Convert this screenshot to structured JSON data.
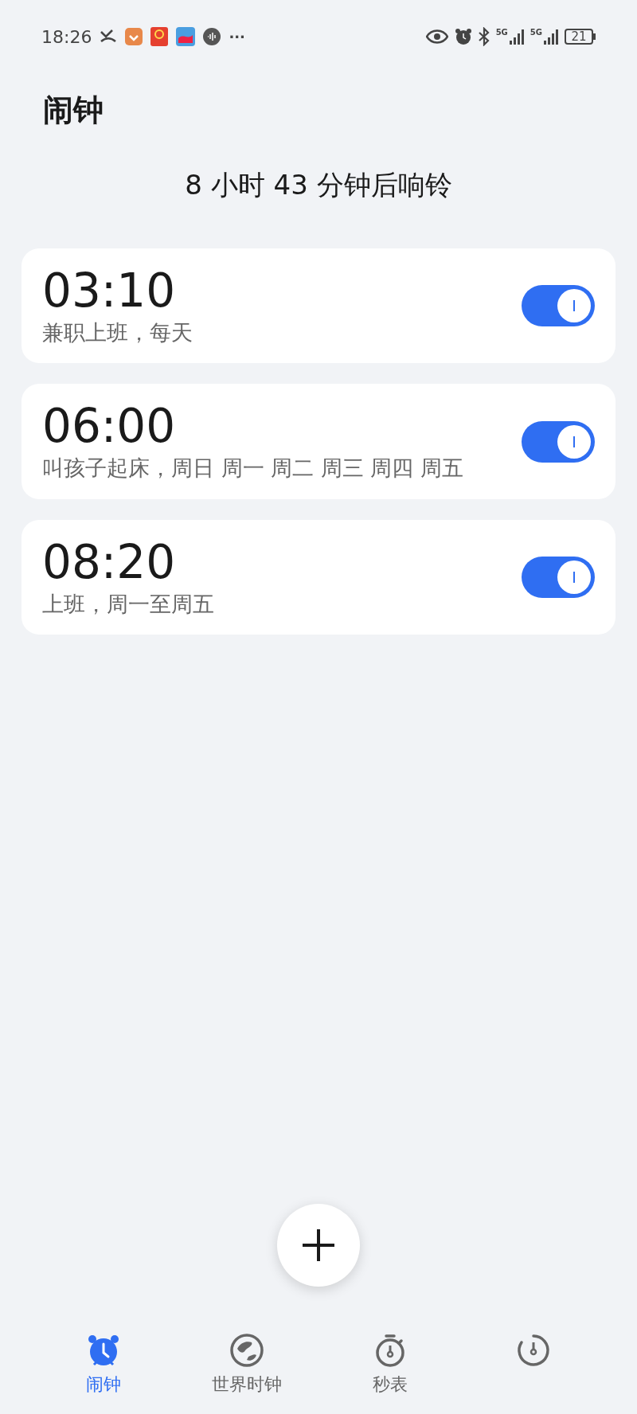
{
  "status_bar": {
    "time": "18:26",
    "more": "···",
    "network": [
      "5G",
      "5G"
    ],
    "battery": "21"
  },
  "title": "闹钟",
  "countdown": "8 小时 43 分钟后响铃",
  "alarms": [
    {
      "time": "03:10",
      "label": "兼职上班，每天",
      "on": true
    },
    {
      "time": "06:00",
      "label": "叫孩子起床，周日 周一 周二 周三 周四 周五",
      "on": true
    },
    {
      "time": "08:20",
      "label": "上班，周一至周五",
      "on": true
    }
  ],
  "nav": [
    {
      "kind": "alarm",
      "label": "闹钟",
      "selected": true
    },
    {
      "kind": "world",
      "label": "世界时钟",
      "selected": false
    },
    {
      "kind": "stopwatch",
      "label": "秒表",
      "selected": false
    },
    {
      "kind": "timer",
      "selected": false
    }
  ]
}
